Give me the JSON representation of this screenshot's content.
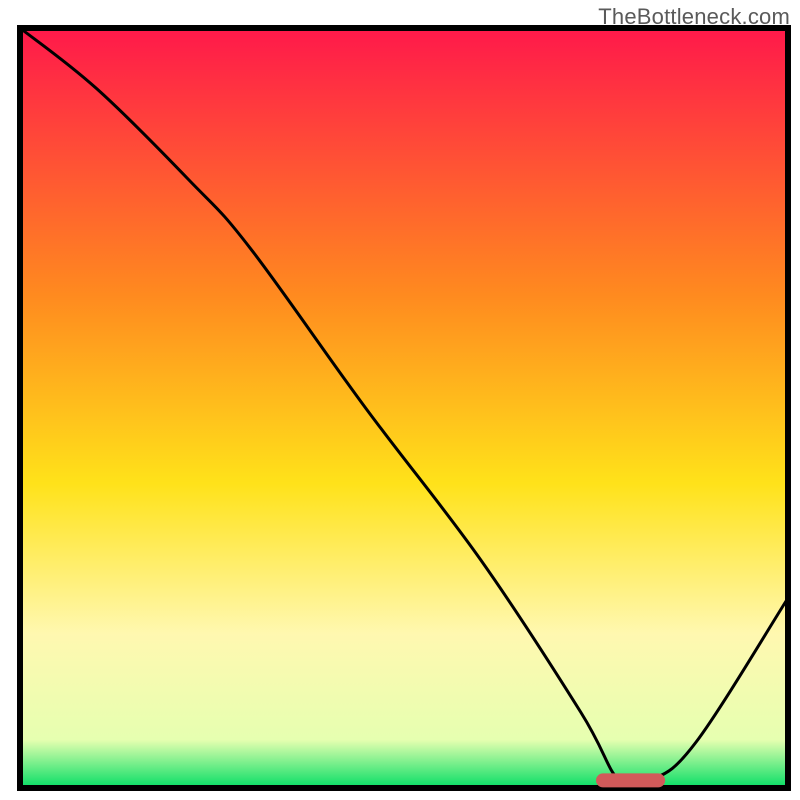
{
  "watermark": "TheBottleneck.com",
  "colors": {
    "border": "#000000",
    "curve": "#000000",
    "top": "#ff1a4a",
    "mid_upper": "#ff8a1f",
    "mid": "#ffe21a",
    "mid_lower": "#fff8b0",
    "green": "#14e06a",
    "marker": "#d15a5a"
  },
  "chart_data": {
    "type": "line",
    "title": "",
    "xlabel": "",
    "ylabel": "",
    "xlim": [
      0,
      100
    ],
    "ylim": [
      0,
      100
    ],
    "series": [
      {
        "name": "curve",
        "x": [
          0,
          10,
          22,
          30,
          45,
          60,
          73,
          78,
          82,
          88,
          100
        ],
        "values": [
          100,
          92,
          80,
          71,
          50,
          30,
          10,
          1,
          1,
          6,
          25
        ]
      }
    ],
    "marker": {
      "x_start": 75,
      "x_end": 84,
      "y": 1
    },
    "background_gradient_stops": [
      {
        "offset": 0,
        "color": "#ff1a4a"
      },
      {
        "offset": 35,
        "color": "#ff8a1f"
      },
      {
        "offset": 60,
        "color": "#ffe21a"
      },
      {
        "offset": 80,
        "color": "#fff8b0"
      },
      {
        "offset": 94,
        "color": "#e6ffb0"
      },
      {
        "offset": 100,
        "color": "#14e06a"
      }
    ]
  }
}
